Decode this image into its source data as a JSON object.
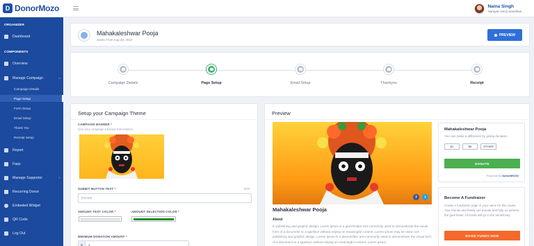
{
  "brand": {
    "name": "DonorMozo",
    "mark": "D"
  },
  "user": {
    "name": "Naina Singh",
    "org": "Narayan Seva Sansthan..."
  },
  "sidebar": {
    "section_organizer": "ORGANIZER",
    "section_components": "COMPONENTS",
    "items": {
      "dashboard": "Dashboard",
      "overview": "Overview",
      "manage_campaign": "Manage Campaign",
      "report": "Report",
      "faqs": "Faqs",
      "manage_supporter": "Manage Supporter",
      "recurring_donor": "Recurring Donor",
      "embedded_widget": "Embeded Widget",
      "qr_code": "QR Code",
      "log_out": "Log Out"
    },
    "sub_items": {
      "campaign_details": "Campaign Details",
      "page_setup": "Page Setup",
      "form_setup": "Form Setup",
      "email_setup": "Email Setup",
      "thank_you": "Thank You",
      "receipt_setup": "Receipt Setup"
    },
    "active_sub": "page_setup",
    "chevron": "›"
  },
  "campaign": {
    "title": "Mahakaleshwar Pooja",
    "start_date": "Starts From Aug 28, 2022",
    "preview_label": "PREVIEW"
  },
  "steps": [
    {
      "label": "Campaign Details",
      "active": false
    },
    {
      "label": "Page Setup",
      "active": true
    },
    {
      "label": "Email Setup",
      "active": false
    },
    {
      "label": "Thankyou",
      "active": false
    },
    {
      "label": "Receipt",
      "active": false
    }
  ],
  "theme": {
    "title": "Setup your Campaign Theme",
    "banner_label": "CAMPAIGN BANNER",
    "banner_hint": "Give your campaign a banner that inspires.",
    "submit_label": "SUBMIT BUTTON TEXT",
    "submit_counter": "6/20",
    "submit_placeholder": "Donate",
    "amount_text_color_label": "AMOUNT TEXT COLOR",
    "amount_selection_color_label": "AMOUNT SELECTION COLOR",
    "amount_text_color": "#ffffff",
    "amount_selection_color": "#1e8e1e",
    "min_amount_label": "MINIMUM DONATION AMOUNT",
    "min_amount_currency": "$",
    "min_amount_value": "1"
  },
  "preview": {
    "title": "Preview",
    "name": "Mahakaleshwar Pooja",
    "about_label": "About",
    "about_text": "In publishing and graphic design, Lorem ipsum is a placeholder text commonly used to demonstrate the visual form of a document or a typeface without relying on meaningful content. Lorem ipsum may be used com publishing and graphic design, Lorem ipsum is a placeholder text commonly used to demonstrate the visual form of a document or a typeface without relying on meaningful content. Lorem ipsum",
    "social": {
      "facebook": "f",
      "twitter": "t"
    },
    "donate_box": {
      "title": "Mahakaleshwar Pooja",
      "subtitle": "You can make a difference by giving donation",
      "amounts": [
        "$1",
        "$8",
        "OTHER"
      ],
      "donate_label": "DONATE",
      "powered_prefix": "Powered By",
      "powered_brand": "DonorMOZO"
    },
    "fund_box": {
      "title": "Become A Fundraizer",
      "description": "Create a fundraizer page in your name for this cause. Your friends and family can donate and help us achieve the goal faster. All funds will go to the beneficiary.",
      "button_label": "RAISE FUNDS NOW"
    }
  },
  "colors": {
    "sidebar": "#1b4a9e",
    "primary": "#2f6fdb",
    "success": "#4caf50",
    "accent": "#f4692c"
  }
}
